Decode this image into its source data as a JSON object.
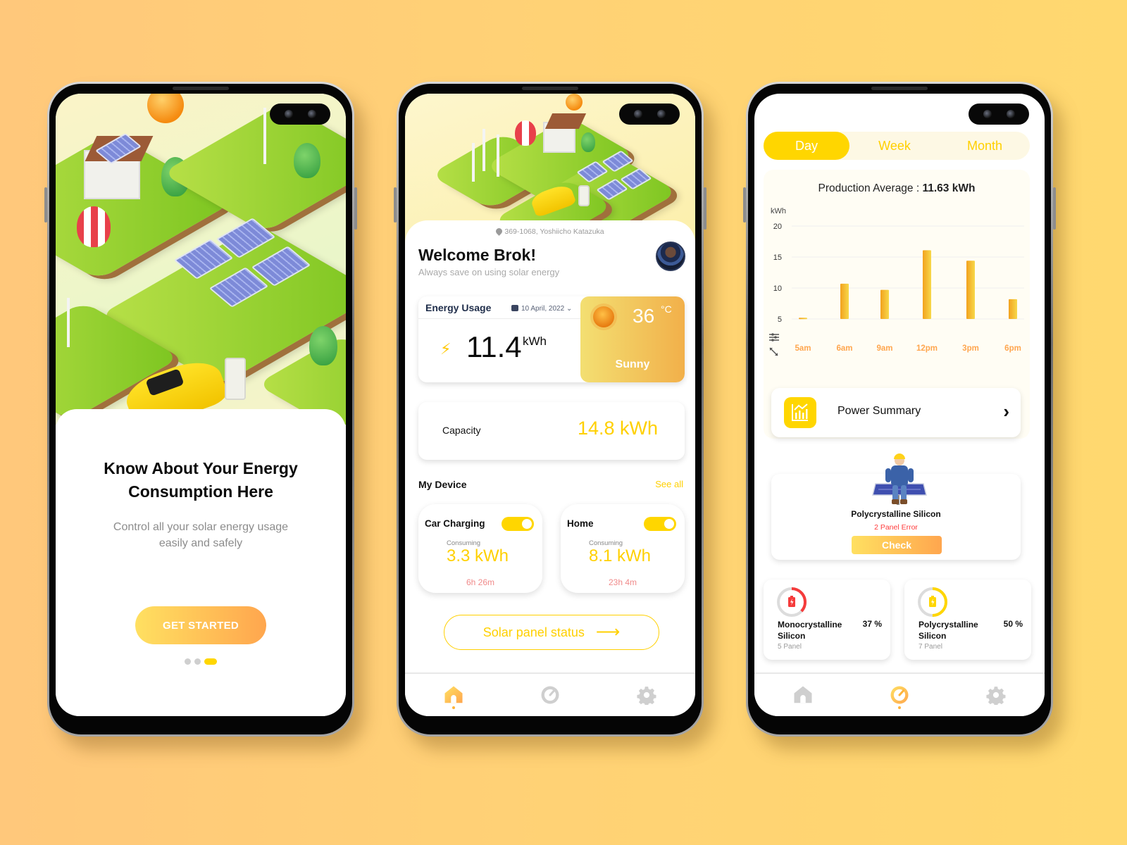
{
  "colors": {
    "accent": "#FFD600",
    "accent_text": "#FFD000",
    "gradient_start": "#FFE061",
    "gradient_end": "#FFA64E",
    "error": "#FF3C3C",
    "muted": "#9A9A9A"
  },
  "onboarding": {
    "title": "Know About Your Energy Consumption Here",
    "subtitle": "Control all your solar energy usage easily and safely",
    "cta_label": "GET STARTED",
    "page_indicator": {
      "total": 3,
      "active": 3
    }
  },
  "home": {
    "location": "369-1068, Yoshiicho Katazuka",
    "greeting": "Welcome Brok!",
    "tagline": "Always save on using solar energy",
    "energy_usage": {
      "label": "Energy Usage",
      "date": "10 April, 2022",
      "value": "11.4",
      "unit": "kWh"
    },
    "weather": {
      "temperature": "36",
      "unit": "°C",
      "condition": "Sunny"
    },
    "capacity": {
      "label": "Capacity",
      "value": "14.8 kWh"
    },
    "devices_section": {
      "title": "My Device",
      "see_all": "See all"
    },
    "devices": [
      {
        "name": "Car Charging",
        "enabled": true,
        "consuming_label": "Consuming",
        "value": "3.3 kWh",
        "duration": "6h 26m"
      },
      {
        "name": "Home",
        "enabled": true,
        "consuming_label": "Consuming",
        "value": "8.1 kWh",
        "duration": "23h 4m"
      }
    ],
    "status_button": "Solar panel status",
    "nav": [
      {
        "icon": "home-icon",
        "active": true
      },
      {
        "icon": "speedometer-icon",
        "active": false
      },
      {
        "icon": "gear-icon",
        "active": false
      }
    ]
  },
  "stats": {
    "tabs": [
      {
        "label": "Day",
        "active": true
      },
      {
        "label": "Week",
        "active": false
      },
      {
        "label": "Month",
        "active": false
      }
    ],
    "production_label": "Production Average :",
    "production_value": "11.63 kWh",
    "power_summary_label": "Power Summary",
    "error_card": {
      "title": "Polycrystalline Silicon",
      "status": "2 Panel Error",
      "button": "Check"
    },
    "panels": [
      {
        "name_line1": "Monocrystalline",
        "name_line2": "Silicon",
        "percent": "37 %",
        "fraction": 0.37,
        "count": "5 Panel",
        "color": "#F53B3B"
      },
      {
        "name_line1": "Polycrystalline",
        "name_line2": "Silicon",
        "percent": "50 %",
        "fraction": 0.5,
        "count": "7 Panel",
        "color": "#FFD600"
      }
    ],
    "nav": [
      {
        "icon": "home-icon",
        "active": false
      },
      {
        "icon": "speedometer-icon",
        "active": true
      },
      {
        "icon": "gear-icon",
        "active": false
      }
    ]
  },
  "chart_data": {
    "type": "bar",
    "title": "Production Average : 11.63 kWh",
    "ylabel": "kWh",
    "xlabel": "",
    "categories": [
      "5am",
      "6am",
      "9am",
      "12pm",
      "3pm",
      "6pm"
    ],
    "values": [
      5.2,
      10.7,
      9.7,
      16.1,
      14.4,
      8.2
    ],
    "ylim": [
      5,
      20
    ],
    "yticks": [
      5,
      10,
      15,
      20
    ],
    "grid": true,
    "legend": "none"
  }
}
